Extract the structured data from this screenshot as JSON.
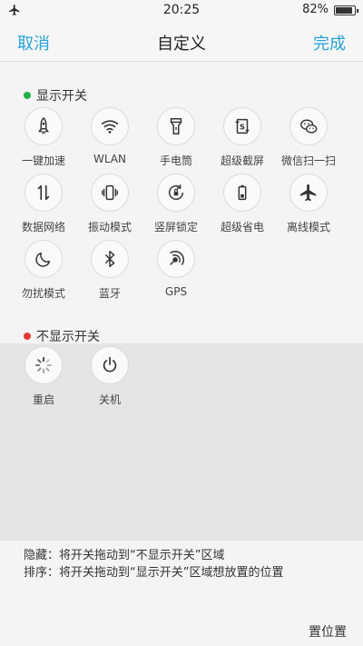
{
  "status_bar": {
    "time": "20:25",
    "battery_percent": "82%",
    "battery_level": 0.82,
    "airplane_icon": "airplane-icon"
  },
  "header": {
    "cancel_label": "取消",
    "title": "自定义",
    "done_label": "完成"
  },
  "shown_section": {
    "title": "显示开关",
    "dot_color": "#22b14c",
    "items": [
      {
        "label": "一键加速",
        "icon": "rocket-icon"
      },
      {
        "label": "WLAN",
        "icon": "wifi-icon"
      },
      {
        "label": "手电筒",
        "icon": "flashlight-icon"
      },
      {
        "label": "超级截屏",
        "icon": "screenshot-icon"
      },
      {
        "label": "微信扫一扫",
        "icon": "wechat-icon"
      },
      {
        "label": "数据网络",
        "icon": "mobile-data-icon"
      },
      {
        "label": "振动模式",
        "icon": "vibrate-icon"
      },
      {
        "label": "竖屏锁定",
        "icon": "rotation-lock-icon"
      },
      {
        "label": "超级省电",
        "icon": "battery-saver-icon"
      },
      {
        "label": "离线模式",
        "icon": "airplane-icon"
      },
      {
        "label": "勿扰模式",
        "icon": "moon-icon"
      },
      {
        "label": "蓝牙",
        "icon": "bluetooth-icon"
      },
      {
        "label": "GPS",
        "icon": "gps-icon"
      }
    ]
  },
  "hidden_section": {
    "title": "不显示开关",
    "dot_color": "#e53935",
    "items": [
      {
        "label": "重启",
        "icon": "restart-icon"
      },
      {
        "label": "关机",
        "icon": "power-icon"
      }
    ]
  },
  "notes": {
    "line1": "隐藏：将开关拖动到“不显示开关”区域",
    "line2": "排序：将开关拖动到“显示开关”区域想放置的位置"
  },
  "bottom_button": "置位置",
  "colors": {
    "accent": "#27a3d8"
  }
}
